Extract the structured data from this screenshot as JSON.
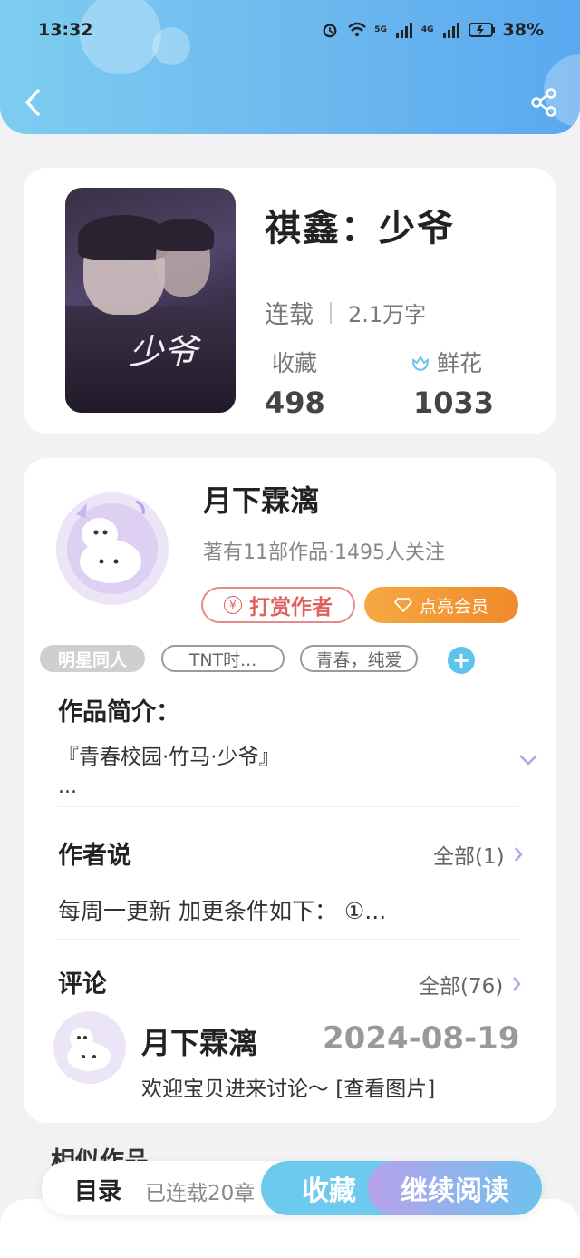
{
  "status_bar": {
    "time": "13:32",
    "signal1": "5G",
    "signal2": "4G",
    "battery": "38%"
  },
  "book": {
    "title": "祺鑫：少爷",
    "cover_text": "少爷",
    "status": "连载",
    "word_count": "2.1万字",
    "favorites_label": "收藏",
    "favorites_count": "498",
    "flowers_label": "鲜花",
    "flowers_count": "1033"
  },
  "author": {
    "name": "月下霖漓",
    "stats": "著有11部作品·1495人关注",
    "reward_label": "打赏作者",
    "vip_label": "点亮会员"
  },
  "tags": [
    "明星同人",
    "TNT时...",
    "青春，纯爱"
  ],
  "intro": {
    "heading": "作品简介：",
    "text": "『青春校园·竹马·少爷』",
    "more": "..."
  },
  "author_says": {
    "heading": "作者说",
    "all_label": "全部(1)",
    "text": "每周一更新  加更条件如下：  ①..."
  },
  "comments": {
    "heading": "评论",
    "all_label": "全部(76)",
    "item": {
      "name": "月下霖漓",
      "date": "2024-08-19",
      "text": "欢迎宝贝进来讨论～  [查看图片]"
    }
  },
  "similar": {
    "heading": "相似作品"
  },
  "bottom": {
    "toc_label": "目录",
    "progress": "已连载20章",
    "collect_label": "收藏",
    "read_label": "继续阅读"
  },
  "colors": {
    "header_start": "#7dcdf0",
    "header_end": "#5aa8f0",
    "accent_purple": "#b7a2ea",
    "reward_red": "#e06060",
    "vip_orange": "#f5a843"
  }
}
